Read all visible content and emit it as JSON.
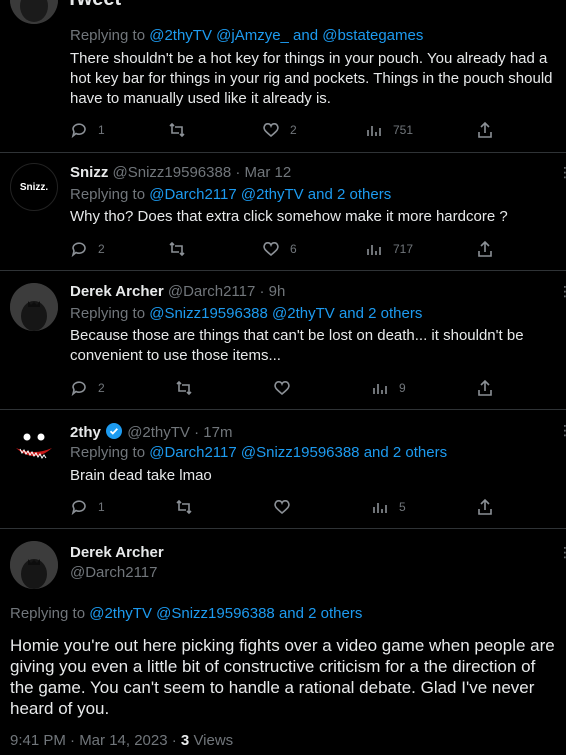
{
  "header": {
    "title": "Tweet"
  },
  "tweets": [
    {
      "reply_prefix": "Replying to",
      "reply_to": "@2thyTV @jAmzye_ and @bstategames",
      "text_lines": [
        "There shouldn't be a hot key for things in your pouch. You already had a",
        "hot key bar for things in your rig and pockets. Things in the pouch should",
        "have to manually used like it already is."
      ],
      "replies": "1",
      "retweets": "",
      "likes": "2",
      "views": "751"
    },
    {
      "name": "Snizz",
      "handle": "@Snizz19596388",
      "time": "· Mar 12",
      "avatar_text": "Snizz.",
      "reply_prefix": "Replying to",
      "reply_to": "@Darch2117 @2thyTV and 2 others",
      "text_lines": [
        "Why tho? Does that extra click somehow make it more hardcore ?"
      ],
      "replies": "2",
      "retweets": "",
      "likes": "6",
      "views": "717"
    },
    {
      "name": "Derek Archer",
      "handle": "@Darch2117",
      "time": "· 9h",
      "reply_prefix": "Replying to",
      "reply_to": "@Snizz19596388 @2thyTV and 2 others",
      "text_lines": [
        "Because those are things that can't be lost on death... it shouldn't be",
        "convenient to use those items..."
      ],
      "replies": "2",
      "retweets": "",
      "likes": "",
      "views": "9"
    },
    {
      "name": "2thy",
      "handle": "@2thyTV",
      "time": "· 17m",
      "reply_prefix": "Replying to",
      "reply_to": "@Darch2117 @Snizz19596388 and 2 others",
      "text_lines": [
        "Brain dead take lmao"
      ],
      "replies": "1",
      "retweets": "",
      "likes": "",
      "views": "5"
    }
  ],
  "main_tweet": {
    "name": "Derek Archer",
    "handle": "@Darch2117",
    "reply_prefix": "Replying to",
    "reply_to": "@2thyTV @Snizz19596388 and 2 others",
    "text_lines": [
      "Homie you're out here picking fights over a video game when people are",
      "giving you even a little bit of constructive criticism for a the direction of",
      "the game. You can't seem to handle a rational debate. Glad I've never",
      "heard of you."
    ],
    "timestamp": "9:41 PM · Mar 14, 2023 ·",
    "views_count": "3",
    "views_label": "Views"
  },
  "colors": {
    "link": "#1d9bf0",
    "muted": "#71767b",
    "background": "#000000"
  }
}
